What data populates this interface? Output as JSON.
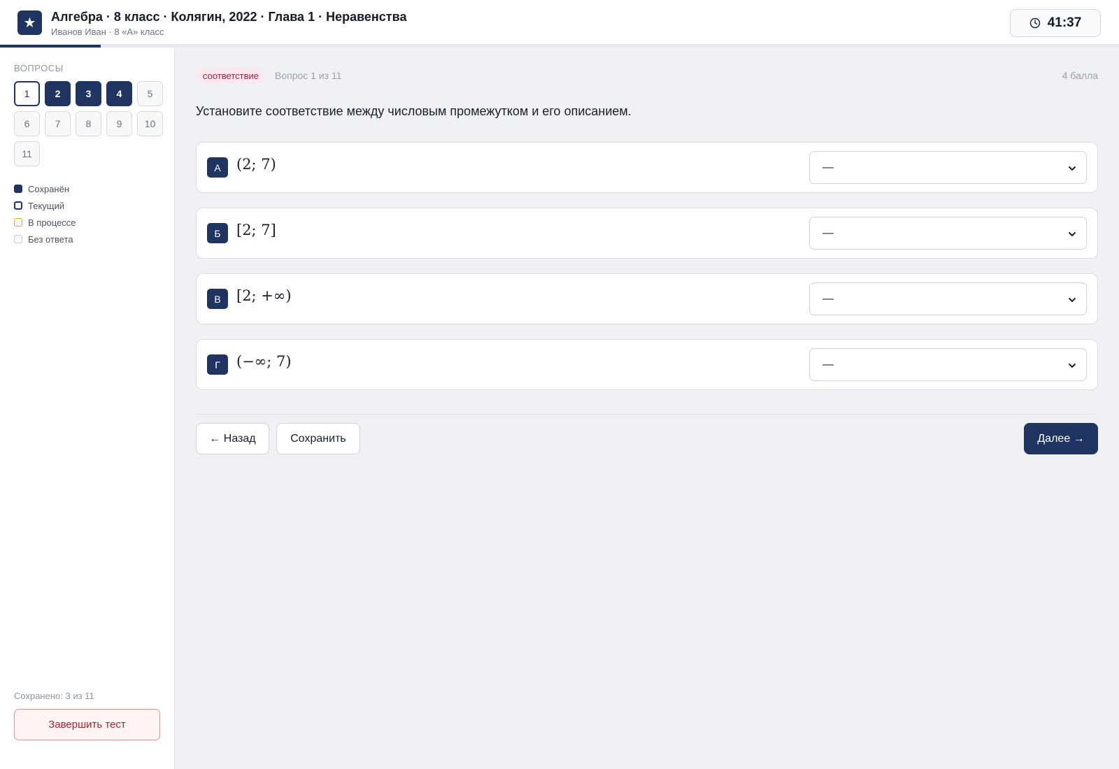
{
  "header": {
    "logo_glyph": "★",
    "title": "Алгебра · 8 класс · Колягин, 2022 · Глава 1 · Неравенства",
    "subtitle": "Иванов Иван · 8 «А» класс",
    "timer": "41:37",
    "progress_fraction": 0.09
  },
  "sidebar": {
    "heading": "ВОПРОСЫ",
    "questions": [
      {
        "n": "1",
        "state": "current"
      },
      {
        "n": "2",
        "state": "saved"
      },
      {
        "n": "3",
        "state": "saved"
      },
      {
        "n": "4",
        "state": "saved"
      },
      {
        "n": "5",
        "state": "none"
      },
      {
        "n": "6",
        "state": "none"
      },
      {
        "n": "7",
        "state": "none"
      },
      {
        "n": "8",
        "state": "none"
      },
      {
        "n": "9",
        "state": "none"
      },
      {
        "n": "10",
        "state": "none"
      },
      {
        "n": "11",
        "state": "none"
      }
    ],
    "legend": [
      {
        "state": "saved",
        "label": "Сохранён"
      },
      {
        "state": "current",
        "label": "Текущий"
      },
      {
        "state": "progress",
        "label": "В процессе"
      },
      {
        "state": "none",
        "label": "Без ответа"
      }
    ],
    "saved_count": "Сохранено: 3 из 11",
    "finish_label": "Завершить тест"
  },
  "question": {
    "tag": "соответствие",
    "number": "Вопрос 1 из 11",
    "points": "4 балла",
    "prompt": "Установите соответствие между числовым промежутком и его описанием.",
    "rows": [
      {
        "letter": "А",
        "expr": "(2; 7)",
        "selected": "—"
      },
      {
        "letter": "Б",
        "expr": "[2; 7]",
        "selected": "—"
      },
      {
        "letter": "В",
        "expr": "[2; +∞)",
        "selected": "—"
      },
      {
        "letter": "Г",
        "expr": "(−∞; 7)",
        "selected": "—"
      }
    ]
  },
  "nav": {
    "back_label": "← Назад",
    "save_label": "Сохранить",
    "next_label": "Далее →"
  },
  "colors": {
    "accent": "#1f3461",
    "danger": "#a3262a",
    "tag_bg": "#fce8ee",
    "in_progress": "#e0a52a"
  }
}
